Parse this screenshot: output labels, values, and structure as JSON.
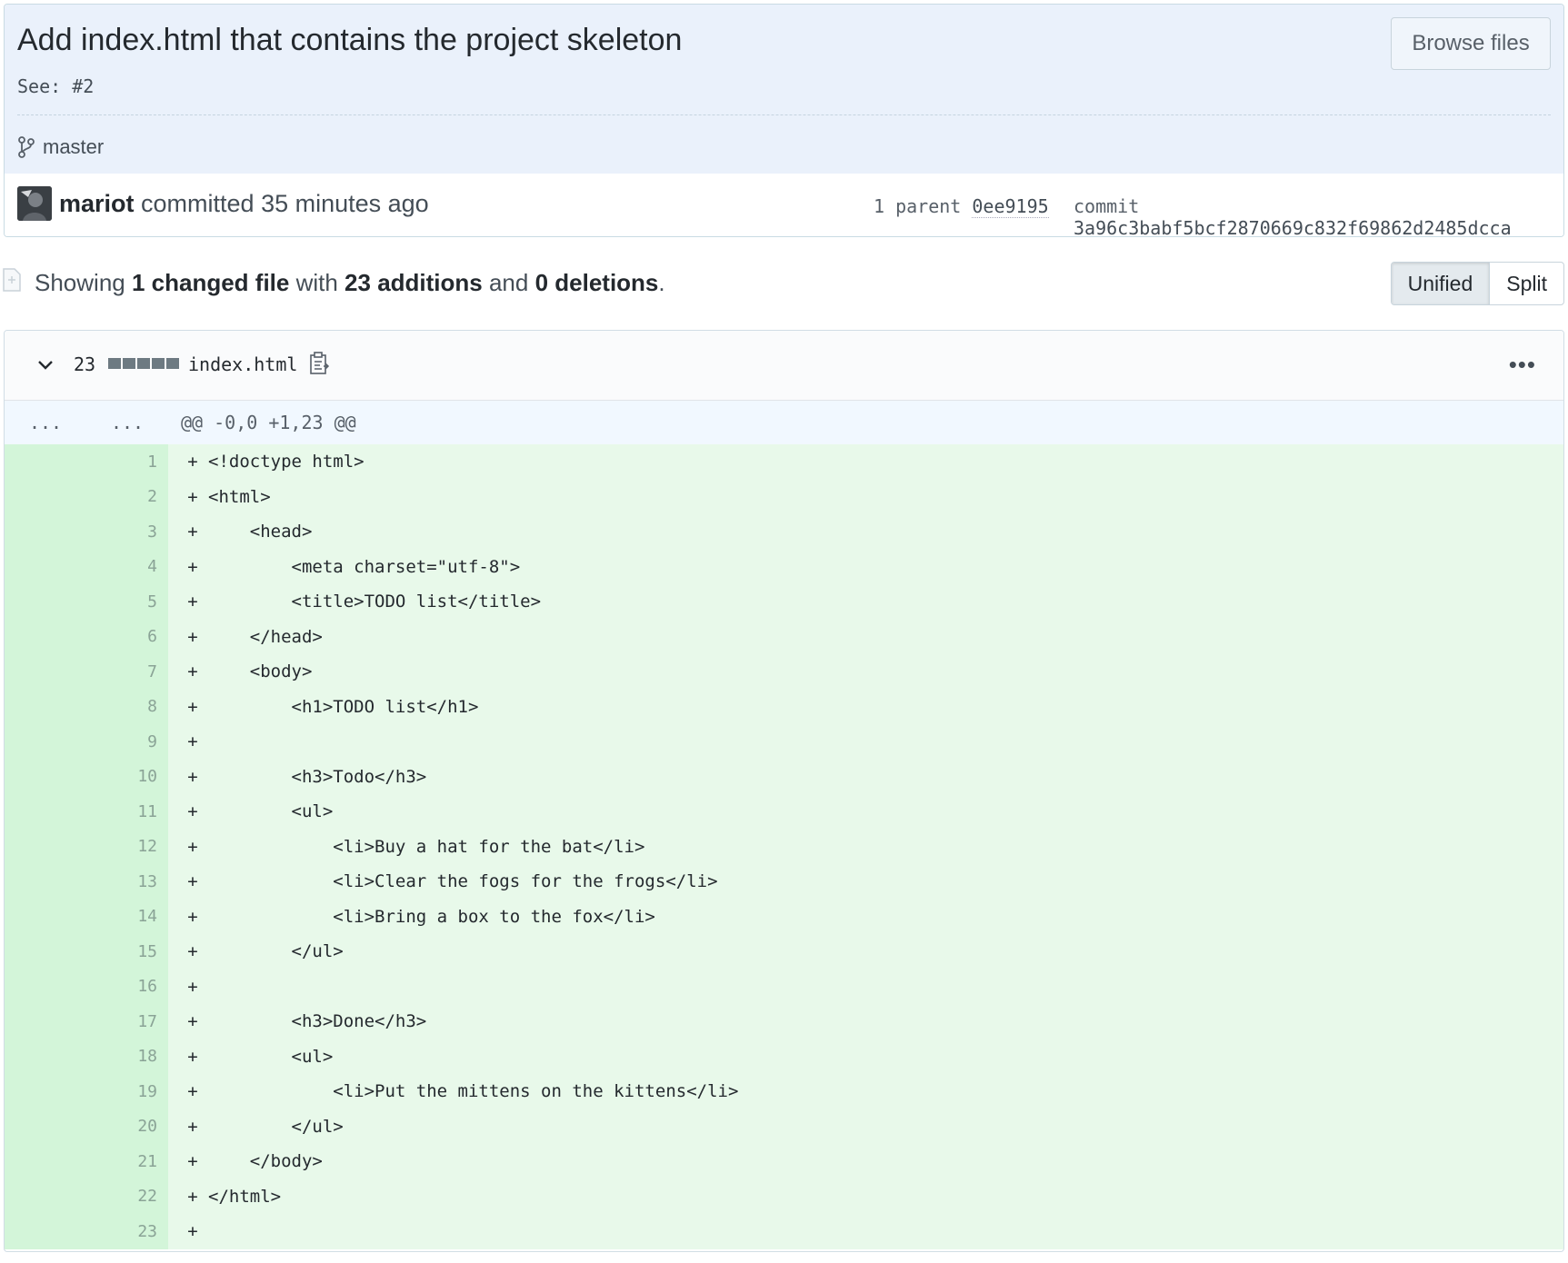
{
  "commit": {
    "title": "Add index.html that contains the project skeleton",
    "description": "See: #2",
    "browse_label": "Browse files",
    "branch": "master",
    "author": "mariot",
    "action_time": " committed 35 minutes ago",
    "parent_label": "1 parent ",
    "parent_sha": "0ee9195",
    "commit_label": "commit ",
    "commit_sha": "3a96c3babf5bcf2870669c832f69862d2485dcca"
  },
  "toc": {
    "showing": "Showing ",
    "changed_files": "1 changed file",
    "with": " with ",
    "additions": "23 additions",
    "and": " and ",
    "deletions": "0 deletions",
    "period": ".",
    "unified_label": "Unified",
    "split_label": "Split"
  },
  "file": {
    "diffstat_count": "23",
    "name": "index.html",
    "more": "•••",
    "hunk_old": "...",
    "hunk_new": "...",
    "hunk_header": "@@ -0,0 +1,23 @@",
    "lines": [
      {
        "n": "1",
        "t": "<!doctype html>"
      },
      {
        "n": "2",
        "t": "<html>"
      },
      {
        "n": "3",
        "t": "    <head>"
      },
      {
        "n": "4",
        "t": "        <meta charset=\"utf-8\">"
      },
      {
        "n": "5",
        "t": "        <title>TODO list</title>"
      },
      {
        "n": "6",
        "t": "    </head>"
      },
      {
        "n": "7",
        "t": "    <body>"
      },
      {
        "n": "8",
        "t": "        <h1>TODO list</h1>"
      },
      {
        "n": "9",
        "t": ""
      },
      {
        "n": "10",
        "t": "        <h3>Todo</h3>"
      },
      {
        "n": "11",
        "t": "        <ul>"
      },
      {
        "n": "12",
        "t": "            <li>Buy a hat for the bat</li>"
      },
      {
        "n": "13",
        "t": "            <li>Clear the fogs for the frogs</li>"
      },
      {
        "n": "14",
        "t": "            <li>Bring a box to the fox</li>"
      },
      {
        "n": "15",
        "t": "        </ul>"
      },
      {
        "n": "16",
        "t": ""
      },
      {
        "n": "17",
        "t": "        <h3>Done</h3>"
      },
      {
        "n": "18",
        "t": "        <ul>"
      },
      {
        "n": "19",
        "t": "            <li>Put the mittens on the kittens</li>"
      },
      {
        "n": "20",
        "t": "        </ul>"
      },
      {
        "n": "21",
        "t": "    </body>"
      },
      {
        "n": "22",
        "t": "</html>"
      },
      {
        "n": "23",
        "t": ""
      }
    ]
  },
  "colors": {
    "addition_gutter": "#d3f5d9",
    "addition_code": "#e8f9ea",
    "hunk_bg": "#f1f8ff",
    "header_bg": "#eaf1fb"
  }
}
